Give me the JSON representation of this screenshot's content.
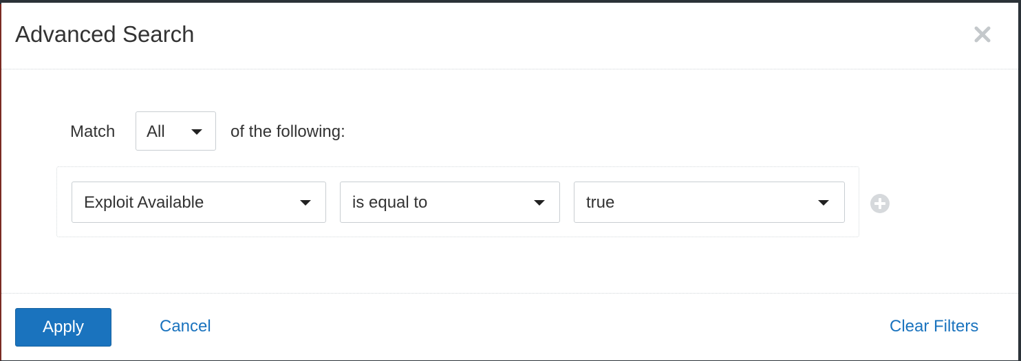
{
  "dialog": {
    "title": "Advanced Search",
    "close_icon": "close-icon"
  },
  "match": {
    "label": "Match",
    "selected": "All",
    "suffix": "of the following:"
  },
  "filter": {
    "field": "Exploit Available",
    "operator": "is equal to",
    "value": "true",
    "add_icon": "plus-circle-icon"
  },
  "footer": {
    "apply_label": "Apply",
    "cancel_label": "Cancel",
    "clear_label": "Clear Filters"
  },
  "colors": {
    "primary": "#1a73be",
    "text": "#333333",
    "border": "#c8cdd1",
    "icon_gray": "#d6d9dc"
  }
}
